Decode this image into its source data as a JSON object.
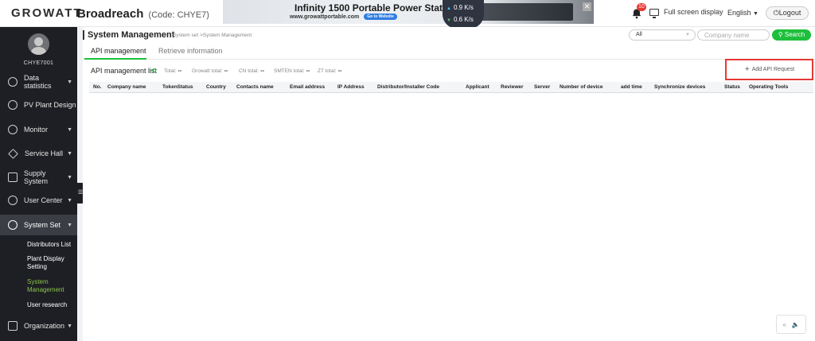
{
  "brand": {
    "logo": "GROWATT"
  },
  "header": {
    "plant_name": "Broadreach",
    "plant_code": "(Code:  CHYE7)",
    "banner_title": "Infinity 1500 Portable Power Station",
    "banner_url": "www.growattportable.com",
    "banner_button": "Go to Website",
    "upload_speed": "0.9 K/s",
    "download_speed": "0.6 K/s",
    "notification_count": "10",
    "fullscreen_label": "Full screen display",
    "language": "English",
    "logout_label": "Logout"
  },
  "sidebar": {
    "username": "CHYE7001",
    "items": [
      {
        "label": "Data statistics",
        "caret": "▼"
      },
      {
        "label": "PV Plant Design",
        "caret": ""
      },
      {
        "label": "Monitor",
        "caret": "▼"
      },
      {
        "label": "Service Hall",
        "caret": "▼"
      },
      {
        "label": "Supply System",
        "caret": "▼"
      },
      {
        "label": "User Center",
        "caret": "▼"
      },
      {
        "label": "System Set",
        "caret": "▼"
      },
      {
        "label": "Organization",
        "caret": "▼"
      }
    ],
    "subitems": [
      {
        "label": "Distributors List"
      },
      {
        "label": "Plant Display Setting"
      },
      {
        "label": "System Management"
      },
      {
        "label": "User research"
      }
    ]
  },
  "page": {
    "title": "System Management",
    "breadcrumb": "System set >System Management",
    "filter_value": "All",
    "company_placeholder": "Company name",
    "search_label": "Search"
  },
  "tabs": [
    {
      "label": "API management"
    },
    {
      "label": "Retrieve information"
    }
  ],
  "list": {
    "title": "API management list",
    "stats": [
      {
        "label": "Total:",
        "value": "--"
      },
      {
        "label": "Growatt total:",
        "value": "--"
      },
      {
        "label": "CN total:",
        "value": "--"
      },
      {
        "label": "SMTEN total:",
        "value": "--"
      },
      {
        "label": "ZT total:",
        "value": "--"
      }
    ],
    "add_button": "Add API Request"
  },
  "table": {
    "columns": [
      "No.",
      "Company name",
      "TokenStatus",
      "Country",
      "Contacts name",
      "Email address",
      "IP Address",
      "Distributor/Installer Code",
      "Applicant",
      "Reviewer",
      "Server",
      "Number of device",
      "add time",
      "Synchronize devices",
      "Status",
      "Operating Tools"
    ]
  },
  "colors": {
    "accent": "#1dbf3b",
    "sidebar_bg": "#1d1f24",
    "highlight": "#e53935"
  }
}
